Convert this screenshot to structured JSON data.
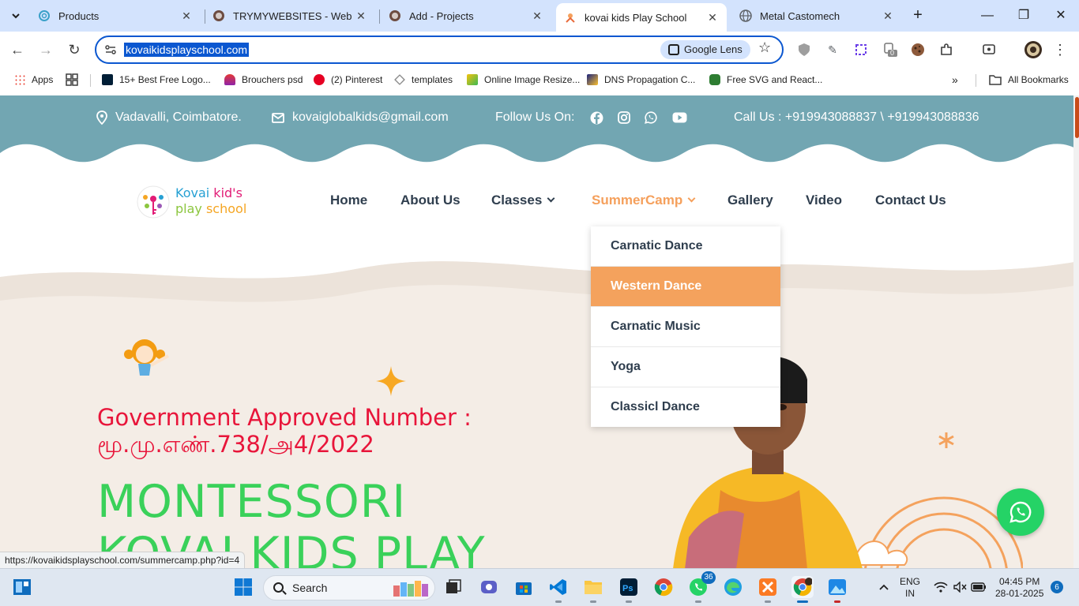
{
  "browser": {
    "tabs": [
      {
        "title": "Products",
        "icon": "swirl-icon"
      },
      {
        "title": "TRYMYWEBSITES - Web Desi",
        "icon": "site-icon"
      },
      {
        "title": "Add - Projects",
        "icon": "site-icon"
      },
      {
        "title": "kovai kids Play School",
        "icon": "kovai-icon",
        "active": true
      },
      {
        "title": "Metal Castomech",
        "icon": "globe-icon"
      }
    ],
    "url": "kovaikidsplayschool.com",
    "lens_label": "Google Lens",
    "extension_badge": "0",
    "bookmarks": [
      {
        "label": "Apps"
      },
      {
        "label": "15+ Best Free Logo..."
      },
      {
        "label": "Brouchers psd"
      },
      {
        "label": "(2) Pinterest"
      },
      {
        "label": "templates"
      },
      {
        "label": "Online Image Resize..."
      },
      {
        "label": "DNS Propagation C..."
      },
      {
        "label": "Free SVG and React..."
      }
    ],
    "all_bookmarks": "All Bookmarks",
    "status_url": "https://kovaikidsplayschool.com/summercamp.php?id=4"
  },
  "site": {
    "location": "Vadavalli, Coimbatore.",
    "email": "kovaiglobalkids@gmail.com",
    "follow_label": "Follow Us On:",
    "phone": "Call Us : +919943088837 \\ +919943088836",
    "logo": {
      "line1_a": "Kovai ",
      "line1_b": "kid's",
      "line2_a": "play ",
      "line2_b": "school"
    },
    "nav": [
      {
        "label": "Home"
      },
      {
        "label": "About Us"
      },
      {
        "label": "Classes"
      },
      {
        "label": "SummerCamp"
      },
      {
        "label": "Gallery"
      },
      {
        "label": "Video"
      },
      {
        "label": "Contact Us"
      }
    ],
    "dropdown": [
      {
        "label": "Carnatic Dance"
      },
      {
        "label": "Western Dance"
      },
      {
        "label": "Carnatic Music"
      },
      {
        "label": "Yoga"
      },
      {
        "label": "Classicl Dance"
      }
    ],
    "gov_line1": "Government Approved Number :",
    "gov_line2": "மூ.மு.எண்.738/அ4/2022",
    "hero_line1": "MONTESSORI",
    "hero_line2": "KOVAI KIDS PLAY",
    "colors": {
      "topbar": "#72a6b2",
      "accent": "#f4a25d",
      "red": "#e8153a",
      "green": "#3ad15a"
    }
  },
  "taskbar": {
    "search_label": "Search",
    "whatsapp_badge": "36",
    "lang_1": "ENG",
    "lang_2": "IN",
    "time": "04:45 PM",
    "date": "28-01-2025",
    "notifications": "6"
  }
}
